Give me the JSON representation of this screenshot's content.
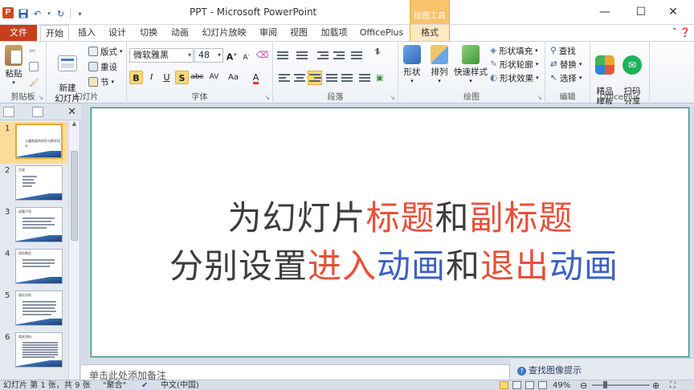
{
  "window": {
    "title": "PPT - Microsoft PowerPoint",
    "contextual_group": "绘图工具",
    "controls": {
      "minimize": "—",
      "maximize": "☐",
      "close": "✕"
    }
  },
  "quick_access": {
    "icons": [
      "save-icon",
      "undo-icon",
      "redo-icon",
      "customize-icon"
    ]
  },
  "tabs": {
    "file": "文件",
    "items": [
      "开始",
      "插入",
      "设计",
      "切换",
      "动画",
      "幻灯片放映",
      "审阅",
      "视图",
      "加载项",
      "OfficePlus",
      "格式"
    ],
    "active": "开始"
  },
  "ribbon": {
    "clipboard": {
      "label": "剪贴板",
      "paste": "粘贴"
    },
    "slides": {
      "label": "幻灯片",
      "new_slide": "新建\n幻灯片",
      "layout": "版式",
      "reset": "重设",
      "section": "节"
    },
    "font": {
      "label": "字体",
      "font_name": "微软雅黑",
      "font_size": "48"
    },
    "paragraph": {
      "label": "段落"
    },
    "drawing": {
      "label": "绘图",
      "shape": "形状",
      "arrange": "排列",
      "quick_styles": "快速样式",
      "fill": "形状填充",
      "outline": "形状轮廓",
      "effects": "形状效果"
    },
    "editing": {
      "label": "编辑",
      "find": "查找",
      "replace": "替换",
      "select": "选择"
    },
    "officeplus": {
      "label": "OfficePlus",
      "templates": "精品\n模板",
      "scan_share": "扫码\n分享"
    }
  },
  "slides_pane": {
    "thumbnails": [
      {
        "number": "1",
        "title": "儿童图画的研究与教学设计"
      },
      {
        "number": "2",
        "title": "目录"
      },
      {
        "number": "3",
        "title": "选题介绍"
      },
      {
        "number": "4",
        "title": "研究概况"
      },
      {
        "number": "5",
        "title": "理论分析"
      },
      {
        "number": "6",
        "title": "相关资料"
      }
    ],
    "selected": 1
  },
  "slide": {
    "line1": [
      {
        "text": "为幻灯片",
        "color": "#3d3d3d"
      },
      {
        "text": "标题",
        "color": "#e8503a"
      },
      {
        "text": "和",
        "color": "#3d3d3d"
      },
      {
        "text": "副标题",
        "color": "#e8503a"
      }
    ],
    "line2": [
      {
        "text": "分别设置",
        "color": "#3d3d3d"
      },
      {
        "text": "进入",
        "color": "#e8503a"
      },
      {
        "text": "动画",
        "color": "#3d61c4"
      },
      {
        "text": "和",
        "color": "#3d3d3d"
      },
      {
        "text": "退出",
        "color": "#e8503a"
      },
      {
        "text": "动画",
        "color": "#3d61c4"
      }
    ]
  },
  "notes": {
    "placeholder": "单击此处添加备注"
  },
  "image_search": {
    "label": "查找图像提示"
  },
  "status": {
    "slide_info": "幻灯片 第 1 张，共 9 张",
    "theme": "\"聚合\"",
    "language": "中文(中国)",
    "zoom": "49%",
    "zoom_level": 0.49
  }
}
